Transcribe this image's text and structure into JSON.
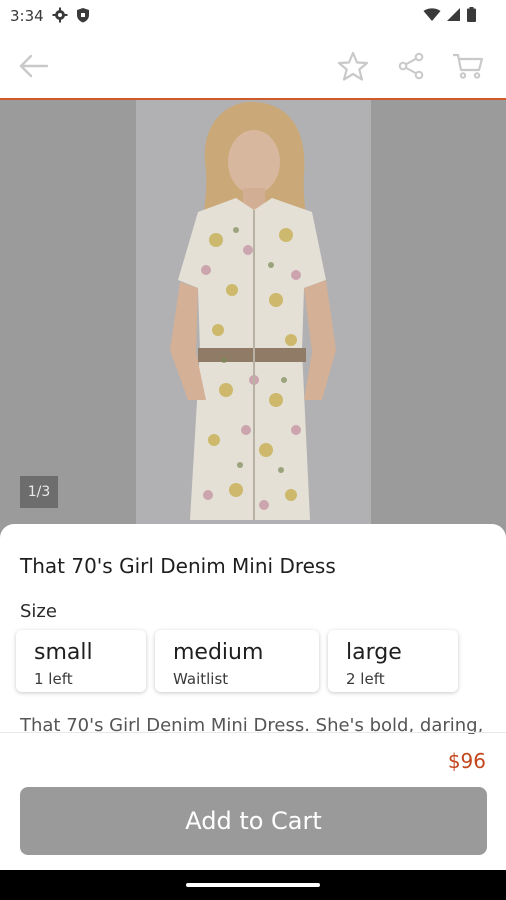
{
  "status_bar": {
    "time": "3:34",
    "icons": [
      "gear-icon",
      "shield-icon",
      "wifi-icon",
      "signal-icon",
      "battery-icon"
    ]
  },
  "toolbar": {
    "icons": [
      "back-arrow-icon",
      "star-icon",
      "share-icon",
      "cart-icon"
    ]
  },
  "gallery": {
    "counter": "1/3"
  },
  "product": {
    "title": "That 70's Girl Denim Mini Dress",
    "size_label": "Size",
    "sizes": [
      {
        "name": "small",
        "stock": "1 left"
      },
      {
        "name": "medium",
        "stock": "Waitlist"
      },
      {
        "name": "large",
        "stock": "2 left"
      }
    ],
    "description": "That 70's Girl Denim Mini Dress. She's bold, daring,",
    "price": "$96",
    "add_to_cart": "Add to Cart"
  },
  "colors": {
    "accent": "#d05a2a",
    "price": "#c2461e",
    "button": "#9a9a9a"
  }
}
